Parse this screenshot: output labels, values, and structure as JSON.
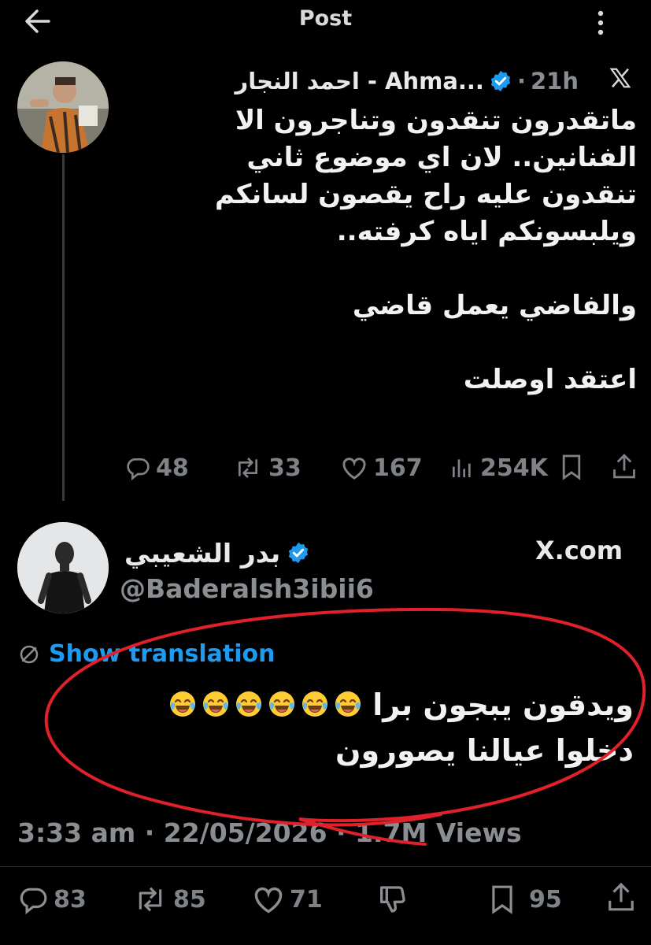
{
  "header": {
    "title": "Post",
    "back_icon": "arrow-left-icon",
    "more_icon": "more-vertical-icon"
  },
  "tweet1": {
    "author_name": "احمد النجار - Ahma...",
    "separator": "·",
    "time": "21h",
    "source_icon": "x-logo-icon",
    "verified_icon": "verified-badge-icon",
    "lines": [
      "ماتقدرون تنقدون وتناجرون الا",
      "الفنانين.. لان اي موضوع ثاني",
      "تنقدون عليه راح يقصون لسانكم",
      "ويلبسونكم اياه كرفته..",
      "والفاضي يعمل قاضي",
      "اعتقد اوصلت"
    ],
    "stats": {
      "replies": "48",
      "reposts": "33",
      "likes": "167",
      "views": "254K"
    }
  },
  "tweet2": {
    "author_name": "بدر الشعيبي",
    "handle": "@Baderalsh3ibii6",
    "source": "X.com",
    "show_translation": "Show translation",
    "line1_text": "ويدقون يبجون برا",
    "line1_emoji_count": 6,
    "line1_emoji": "face-with-tears-of-joy",
    "line2": "دخلوا عيالنا يصورون",
    "meta": "3:33 am · 22/05/2026 · 1.7M Views",
    "stats": {
      "replies": "83",
      "reposts": "85",
      "likes": "71",
      "bookmarks": "95"
    }
  },
  "colors": {
    "background": "#000000",
    "text": "#e7e9ea",
    "muted": "#8a8d91",
    "link": "#1d9bf0",
    "verified": "#1d9bf0",
    "annotation": "#e0202a"
  }
}
